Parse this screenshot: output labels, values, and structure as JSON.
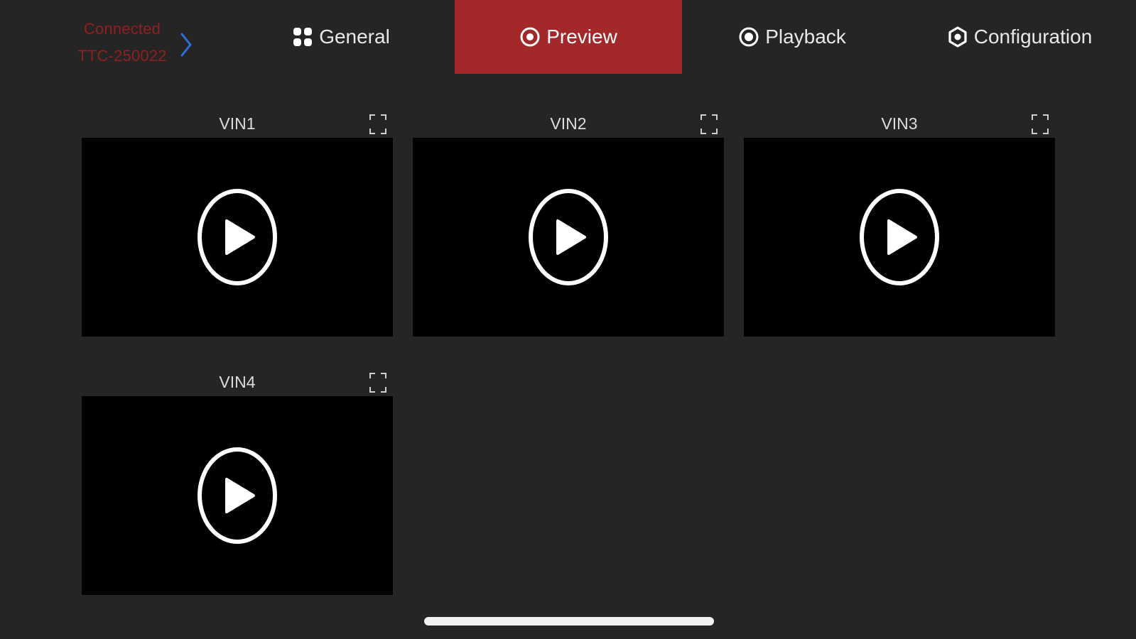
{
  "device": {
    "status": "Connected",
    "name": "TTC-250022",
    "status_color": "#8e2020",
    "chevron_color": "#2f6fd6",
    "icon": "chevron-right-icon"
  },
  "tabs": [
    {
      "label": "General",
      "icon": "grid-icon",
      "active": false
    },
    {
      "label": "Preview",
      "icon": "target-icon",
      "active": true
    },
    {
      "label": "Playback",
      "icon": "record-icon",
      "active": false
    },
    {
      "label": "Configuration",
      "icon": "gear-icon",
      "active": false
    }
  ],
  "accent_color": "#a22829",
  "channels": [
    {
      "title": "VIN1",
      "fullscreen_icon": "fullscreen-icon",
      "play_icon": "play-icon"
    },
    {
      "title": "VIN2",
      "fullscreen_icon": "fullscreen-icon",
      "play_icon": "play-icon"
    },
    {
      "title": "VIN3",
      "fullscreen_icon": "fullscreen-icon",
      "play_icon": "play-icon"
    },
    {
      "title": "VIN4",
      "fullscreen_icon": "fullscreen-icon",
      "play_icon": "play-icon"
    }
  ]
}
